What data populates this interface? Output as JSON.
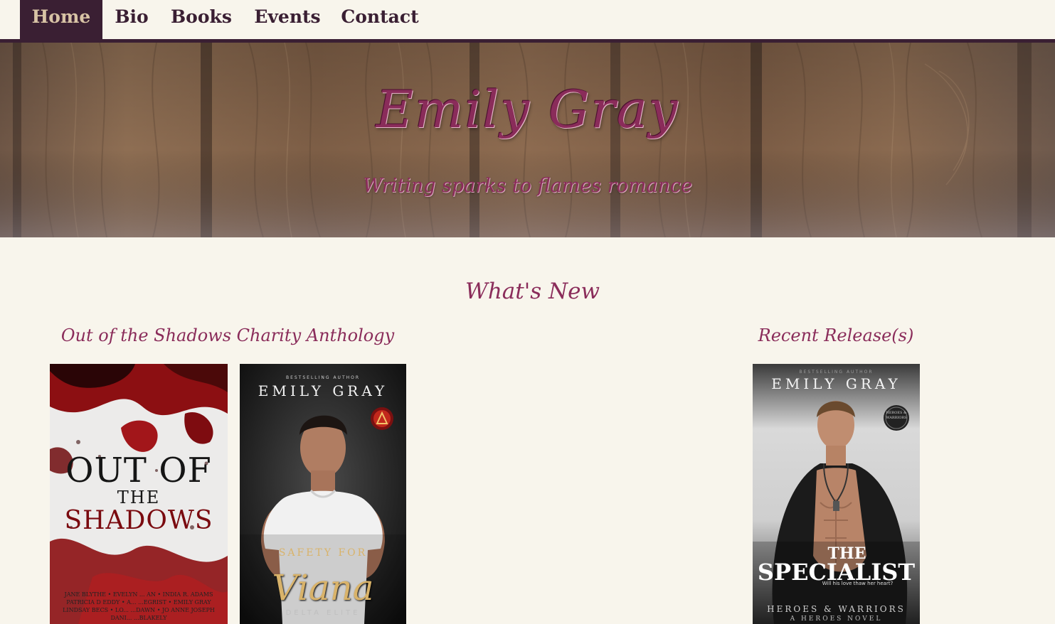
{
  "nav": {
    "items": [
      {
        "label": "Home",
        "active": true
      },
      {
        "label": "Bio",
        "active": false
      },
      {
        "label": "Books",
        "active": false
      },
      {
        "label": "Events",
        "active": false
      },
      {
        "label": "Contact",
        "active": false
      }
    ]
  },
  "hero": {
    "title": "Emily Gray",
    "subtitle": "Writing sparks to flames romance"
  },
  "main": {
    "section_title": "What's New",
    "left_heading": "Out of the Shadows Charity Anthology",
    "right_heading": "Recent Release(s)",
    "books": {
      "shadows": {
        "title_line1": "OUT OF",
        "title_line2": "THE",
        "title_line3": "SHADOWS",
        "authors_1": "JANE BLYTHE • EVELYN ... AN • INDIA R. ADAMS",
        "authors_2": "PATRICIA D EDDY • A... ...EGRIST • EMILY GRAY",
        "authors_3": "LINDSAY BECS • LO... ...DAWN • JO ANNE JOSEPH",
        "authors_4": "DANI... ...BLAKELY"
      },
      "viana": {
        "kicker": "BESTSELLING AUTHOR",
        "author": "EMILY GRAY",
        "subtitle": "SAFETY FOR",
        "title": "Viana",
        "series": "DELTA ELITE"
      },
      "specialist": {
        "kicker": "BESTSELLING AUTHOR",
        "author": "EMILY GRAY",
        "badge": "HEROES & WARRIORS",
        "title_line1": "THE",
        "title_line2": "SPECIALIST",
        "tagline": "Will his love thaw her heart?",
        "series": "HEROES & WARRIORS",
        "series_sub": "A HEROES NOVEL"
      }
    }
  },
  "colors": {
    "nav_dark": "#3a1f33",
    "nav_active_text": "#d8c3a5",
    "accent": "#8a2c5a",
    "page_bg": "#f8f5ec",
    "wood": "#8a6a4f"
  }
}
